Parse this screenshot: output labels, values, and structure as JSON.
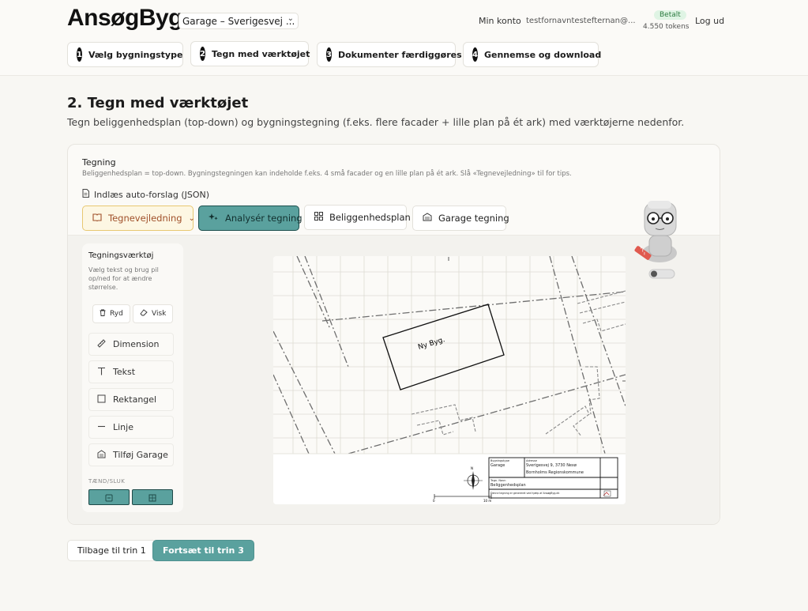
{
  "app": {
    "logo": "AnsøgByg",
    "project": "Garage – Sverigesvej ..."
  },
  "account": {
    "my_account": "Min konto",
    "email": "testfornavntestefternan@...",
    "status_badge": "Betalt",
    "tokens": "4.550 tokens",
    "logout": "Log ud"
  },
  "steps": [
    {
      "num": "1",
      "label": "Vælg bygningstype"
    },
    {
      "num": "2",
      "label": "Tegn med værktøjet"
    },
    {
      "num": "3",
      "label": "Dokumenter færdiggøres"
    },
    {
      "num": "4",
      "label": "Gennemse og download"
    }
  ],
  "page": {
    "title": "2. Tegn med værktøjet",
    "subtitle": "Tegn beliggenhedsplan (top-down) og bygningstegning (f.eks. flere facader + lille plan på ét ark) med værktøjerne nedenfor."
  },
  "drawing_card": {
    "title": "Tegning",
    "hint": "Beliggenhedsplan = top-down. Bygningstegningen kan indeholde f.eks. 4 små facader og en lille plan på ét ark. Slå «Tegnevejledning» til for tips.",
    "json_link": "Indlæs auto-forslag (JSON)",
    "guide_button": "Tegnevejledning",
    "analyze_button": "Analysér tegning",
    "site_plan_button": "Beliggenhedsplan",
    "garage_drawing_button": "Garage tegning"
  },
  "tools": {
    "title": "Tegningsværktøj",
    "hint": "Vælg tekst og brug pil op/ned for at ændre størrelse.",
    "clear": "Ryd",
    "erase": "Visk",
    "items": [
      "Dimension",
      "Tekst",
      "Rektangel",
      "Linje",
      "Tilføj Garage"
    ],
    "toggle_label": "TÆND/SLUK"
  },
  "canvas": {
    "building_label": "Ny Byg.",
    "north": "N",
    "scale_zero": "0",
    "scale_end": "10 m",
    "titleblock": {
      "type_label": "Bygningstype",
      "type_value": "Garage",
      "address_label": "Adresse",
      "address_line1": "Sverigesvej 9, 3730 Nexø",
      "address_line2": "Bornholms Regionskommune",
      "drawing_label": "Tegn. Navn",
      "drawing_value": "Beliggenhedsplan",
      "footer": "Denne tegning er genereret ved hjælp af AnsøgByg.dk"
    }
  },
  "footer": {
    "back": "Tilbage til trin 1",
    "next": "Fortsæt til trin 3"
  },
  "colors": {
    "accent": "#5aa19e",
    "background": "#f8f7f3",
    "guide_border": "#e8c871",
    "badge_bg": "#dff4e4"
  }
}
